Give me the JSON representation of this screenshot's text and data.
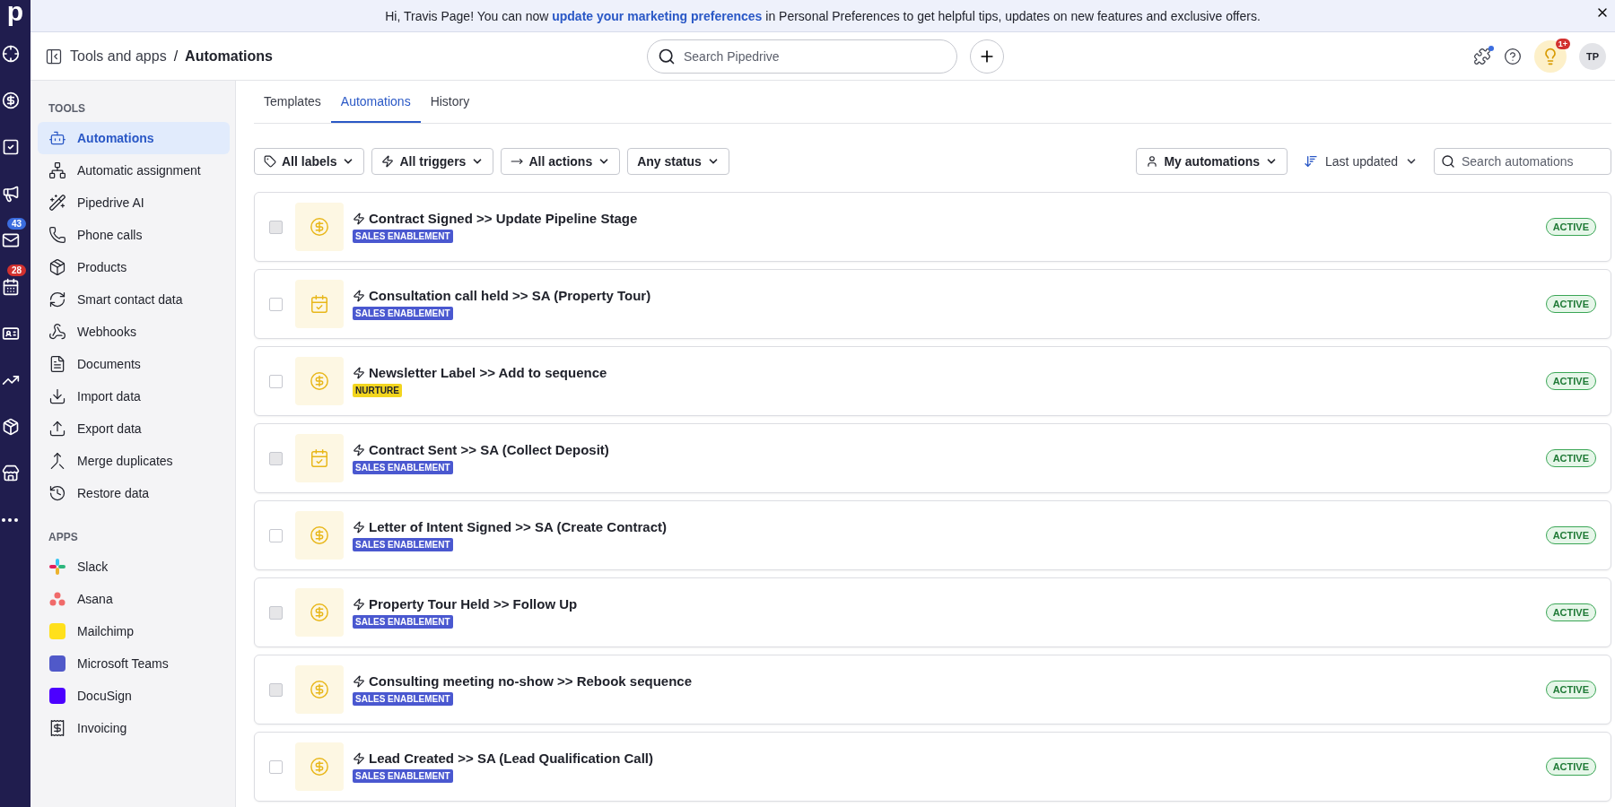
{
  "rail": {
    "logo": "p",
    "items": [
      {
        "kind": "target"
      },
      {
        "kind": "dollar"
      },
      {
        "kind": "tasks"
      },
      {
        "kind": "megaphone"
      },
      {
        "kind": "mail",
        "badge": "43",
        "color": "#3b6de0"
      },
      {
        "kind": "calendar",
        "badge": "28",
        "color": "#d2312f"
      },
      {
        "kind": "card"
      },
      {
        "kind": "chart"
      },
      {
        "kind": "box"
      },
      {
        "kind": "store"
      },
      {
        "kind": "more"
      }
    ]
  },
  "banner": {
    "before": "Hi, Travis Page! You can now ",
    "link": "update your marketing preferences",
    "after": " in Personal Preferences to get helpful tips, updates on new features and exclusive offers."
  },
  "header": {
    "breadcrumb": "Tools and apps",
    "separator": "/",
    "title": "Automations",
    "search_placeholder": "Search Pipedrive",
    "notification_badge": "1+",
    "avatar": "TP"
  },
  "sidebar": {
    "sections": [
      {
        "title": "TOOLS",
        "items": [
          {
            "label": "Automations",
            "kind": "robot",
            "selected": true
          },
          {
            "label": "Automatic assignment",
            "kind": "assign",
            "selected": false
          },
          {
            "label": "Pipedrive AI",
            "kind": "wand",
            "selected": false
          },
          {
            "label": "Phone calls",
            "kind": "phone",
            "selected": false
          },
          {
            "label": "Products",
            "kind": "box",
            "selected": false
          },
          {
            "label": "Smart contact data",
            "kind": "sync",
            "selected": false
          },
          {
            "label": "Webhooks",
            "kind": "webhook",
            "selected": false
          },
          {
            "label": "Documents",
            "kind": "doc",
            "selected": false
          },
          {
            "label": "Import data",
            "kind": "download",
            "selected": false
          },
          {
            "label": "Export data",
            "kind": "upload",
            "selected": false
          },
          {
            "label": "Merge duplicates",
            "kind": "merge",
            "selected": false
          },
          {
            "label": "Restore data",
            "kind": "history",
            "selected": false
          }
        ]
      },
      {
        "title": "APPS",
        "items": [
          {
            "label": "Slack",
            "kind": "slack",
            "selected": false
          },
          {
            "label": "Asana",
            "kind": "asana",
            "selected": false
          },
          {
            "label": "Mailchimp",
            "kind": "mailchimp",
            "selected": false
          },
          {
            "label": "Microsoft Teams",
            "kind": "teams",
            "selected": false
          },
          {
            "label": "DocuSign",
            "kind": "docusign",
            "selected": false
          },
          {
            "label": "Invoicing",
            "kind": "invoice",
            "selected": false
          }
        ]
      }
    ]
  },
  "tabs": [
    {
      "label": "Templates",
      "selected": false
    },
    {
      "label": "Automations",
      "selected": true
    },
    {
      "label": "History",
      "selected": false
    }
  ],
  "filters": [
    {
      "label": "All labels",
      "kind": "tag"
    },
    {
      "label": "All triggers",
      "kind": "zap"
    },
    {
      "label": "All actions",
      "kind": "arrow"
    },
    {
      "label": "Any status",
      "kind": "plain"
    }
  ],
  "owner_filter": "My automations",
  "sort": "Last updated",
  "search_placeholder": "Search automations",
  "automations": [
    {
      "name": "Contract Signed >> Update Pipeline Stage",
      "kind": "dollar",
      "tag": "SALES ENABLEMENT",
      "color": "#4a58d0",
      "status": "ACTIVE",
      "disabled": true
    },
    {
      "name": "Consultation call held >> SA (Property Tour)",
      "kind": "calendar",
      "tag": "SALES ENABLEMENT",
      "color": "#4a58d0",
      "status": "ACTIVE",
      "disabled": false
    },
    {
      "name": "Newsletter Label >> Add to sequence",
      "kind": "dollar",
      "tag": "NURTURE",
      "color": "#f2d51f",
      "status": "ACTIVE",
      "disabled": false
    },
    {
      "name": "Contract Sent >> SA (Collect Deposit)",
      "kind": "calendar",
      "tag": "SALES ENABLEMENT",
      "color": "#4a58d0",
      "status": "ACTIVE",
      "disabled": true
    },
    {
      "name": "Letter of Intent Signed >> SA (Create Contract)",
      "kind": "dollar",
      "tag": "SALES ENABLEMENT",
      "color": "#4a58d0",
      "status": "ACTIVE",
      "disabled": false
    },
    {
      "name": "Property Tour Held >> Follow Up",
      "kind": "dollar",
      "tag": "SALES ENABLEMENT",
      "color": "#4a58d0",
      "status": "ACTIVE",
      "disabled": true
    },
    {
      "name": "Consulting meeting no-show >> Rebook sequence",
      "kind": "dollar",
      "tag": "SALES ENABLEMENT",
      "color": "#4a58d0",
      "status": "ACTIVE",
      "disabled": true
    },
    {
      "name": "Lead Created >> SA (Lead Qualification Call)",
      "kind": "dollar",
      "tag": "SALES ENABLEMENT",
      "color": "#4a58d0",
      "status": "ACTIVE",
      "disabled": false
    }
  ]
}
